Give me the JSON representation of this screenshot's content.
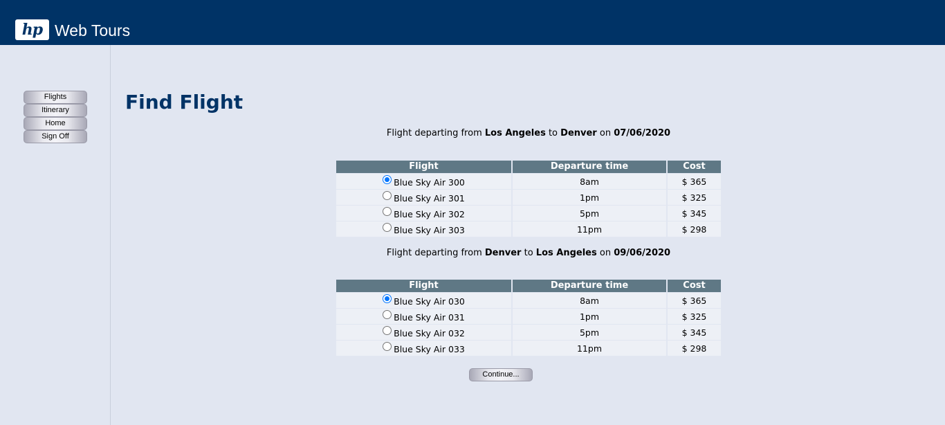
{
  "header": {
    "logo_text": "hp",
    "brand": "Web Tours",
    "bg_color": "#003366"
  },
  "nav": [
    {
      "label": "Flights"
    },
    {
      "label": "Itinerary"
    },
    {
      "label": "Home"
    },
    {
      "label": "Sign Off"
    }
  ],
  "page_title": "Find Flight",
  "outbound": {
    "prefix": "Flight departing from",
    "from": "Los Angeles",
    "to_word": "to",
    "to": "Denver",
    "on_word": "on",
    "date": "07/06/2020",
    "columns": [
      "Flight",
      "Departure time",
      "Cost"
    ],
    "rows": [
      {
        "flight": "Blue Sky Air 300",
        "time": "8am",
        "cost": "$ 365",
        "selected": true
      },
      {
        "flight": "Blue Sky Air 301",
        "time": "1pm",
        "cost": "$ 325",
        "selected": false
      },
      {
        "flight": "Blue Sky Air 302",
        "time": "5pm",
        "cost": "$ 345",
        "selected": false
      },
      {
        "flight": "Blue Sky Air 303",
        "time": "11pm",
        "cost": "$ 298",
        "selected": false
      }
    ]
  },
  "return": {
    "prefix": "Flight departing from",
    "from": "Denver",
    "to_word": "to",
    "to": "Los Angeles",
    "on_word": "on",
    "date": "09/06/2020",
    "columns": [
      "Flight",
      "Departure time",
      "Cost"
    ],
    "rows": [
      {
        "flight": "Blue Sky Air 030",
        "time": "8am",
        "cost": "$ 365",
        "selected": true
      },
      {
        "flight": "Blue Sky Air 031",
        "time": "1pm",
        "cost": "$ 325",
        "selected": false
      },
      {
        "flight": "Blue Sky Air 032",
        "time": "5pm",
        "cost": "$ 345",
        "selected": false
      },
      {
        "flight": "Blue Sky Air 033",
        "time": "11pm",
        "cost": "$ 298",
        "selected": false
      }
    ]
  },
  "continue_label": "Continue..."
}
